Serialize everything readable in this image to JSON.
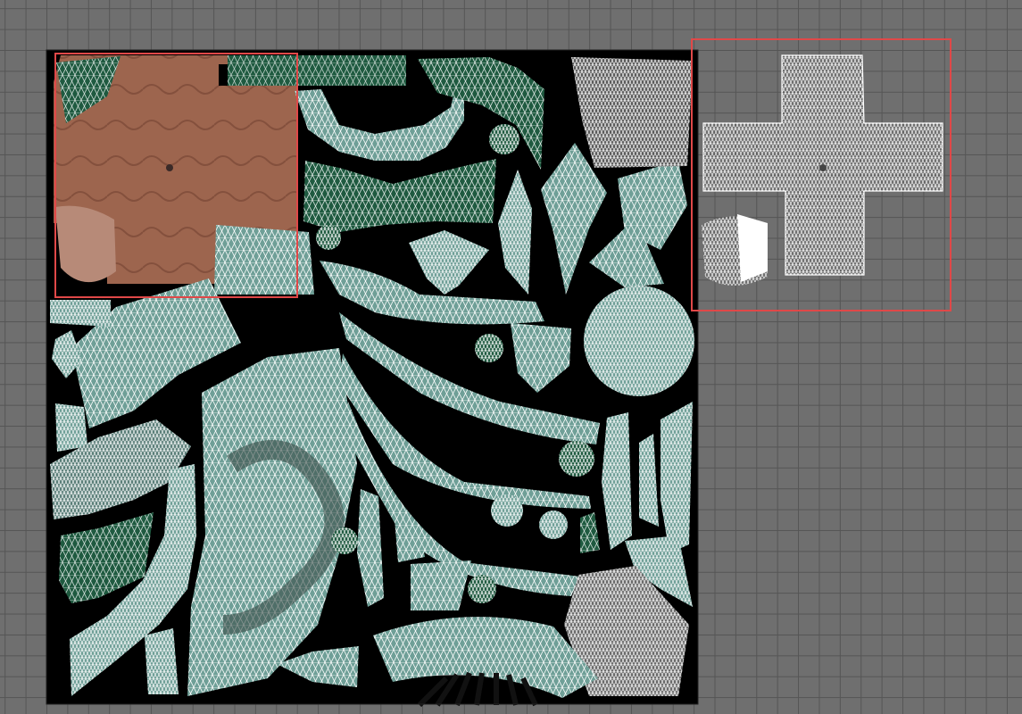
{
  "app": {
    "view": "uv-editor"
  },
  "colors": {
    "background": "#6f6f6f",
    "grid_line": "#555555",
    "texture_base": "#000000",
    "island_fill": "#6f9f97",
    "island_dark_fill": "#1f5a40",
    "skin_fill": "#a56a52",
    "wire": "#ffffff",
    "selection_outline": "#e04848"
  },
  "icons": {
    "uv_grid": "grid-icon",
    "selection": "selection-rectangle"
  }
}
